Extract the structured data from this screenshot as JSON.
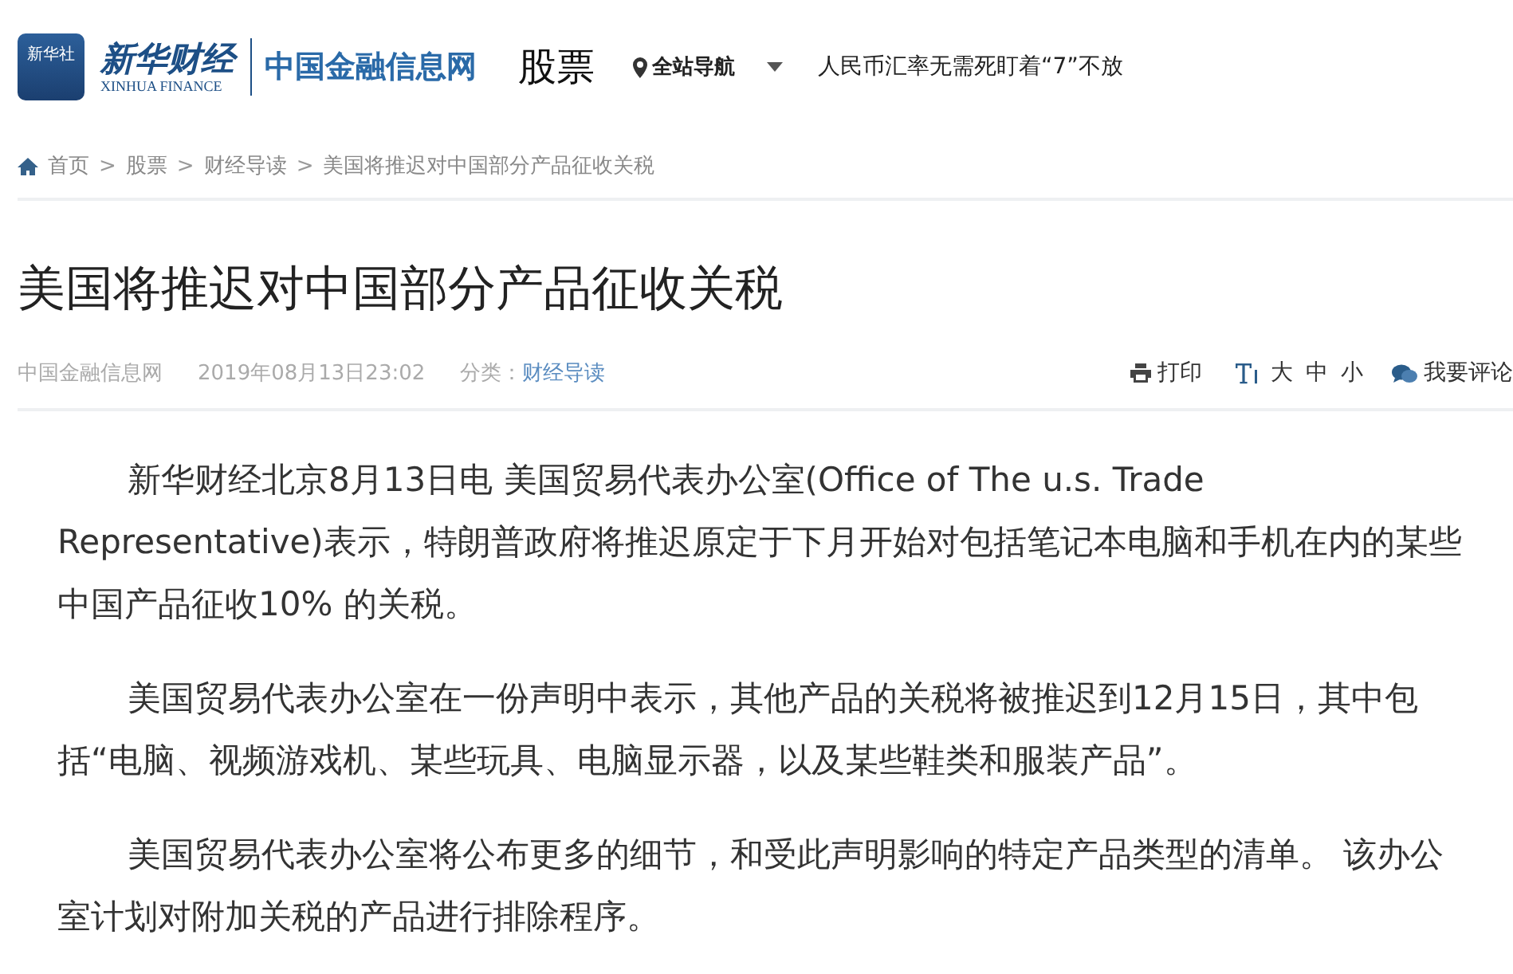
{
  "header": {
    "logo_badge": "新华社",
    "brand": "新华财经",
    "brand_en": "XINHUA FINANCE",
    "site": "中国金融信息网",
    "section": "股票",
    "nav": "全站导航",
    "headline_link": "人民币汇率无需死盯着“7”不放"
  },
  "breadcrumb_separator": ">",
  "breadcrumb": [
    "首页",
    "股票",
    "财经导读",
    "美国将推迟对中国部分产品征收关税"
  ],
  "article": {
    "title": "美国将推迟对中国部分产品征收关税",
    "source": "中国金融信息网",
    "time": "2019年08月13日23:02",
    "category_label": "分类：",
    "category": "财经导读",
    "tools": {
      "print": "打印",
      "size_large": "大",
      "size_medium": "中",
      "size_small": "小",
      "comment": "我要评论"
    },
    "paragraphs": [
      "新华财经北京8月13日电 美国贸易代表办公室(Office of The u.s. Trade Representative)表示，特朗普政府将推迟原定于下月开始对包括笔记本电脑和手机在内的某些中国产品征收10% 的关税。",
      "美国贸易代表办公室在一份声明中表示，其他产品的关税将被推迟到12月15日，其中包括“电脑、视频游戏机、某些玩具、电脑显示器，以及某些鞋类和服装产品”。",
      "美国贸易代表办公室将公布更多的细节，和受此声明影响的特定产品类型的清单。 该办公室计划对附加关税的产品进行排除程序。"
    ]
  }
}
